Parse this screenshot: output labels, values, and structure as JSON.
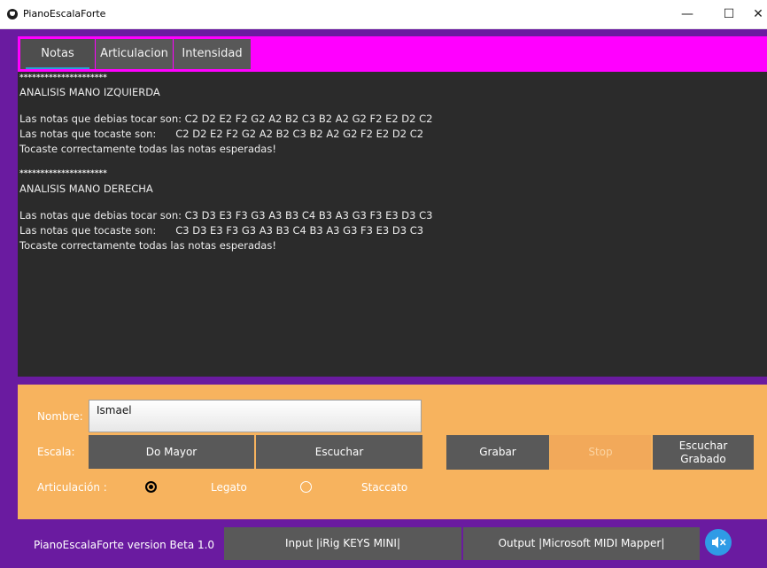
{
  "window": {
    "title": "PianoEscalaForte",
    "minimize": "—",
    "maximize": "☐",
    "close": "✕"
  },
  "tabs": [
    "Notas",
    "Articulacion",
    "Intensidad"
  ],
  "output": {
    "lines": [
      "*********************",
      "ANALISIS MANO IZQUIERDA",
      "",
      "Las notas que debias tocar son: C2 D2 E2 F2 G2 A2 B2 C3 B2 A2 G2 F2 E2 D2 C2",
      "Las notas que tocaste son:      C2 D2 E2 F2 G2 A2 B2 C3 B2 A2 G2 F2 E2 D2 C2",
      "Tocaste correctamente todas las notas esperadas!",
      "",
      "*********************",
      "ANALISIS MANO DERECHA",
      "",
      "Las notas que debias tocar son: C3 D3 E3 F3 G3 A3 B3 C4 B3 A3 G3 F3 E3 D3 C3",
      "Las notas que tocaste son:      C3 D3 E3 F3 G3 A3 B3 C4 B3 A3 G3 F3 E3 D3 C3",
      "Tocaste correctamente todas las notas esperadas!"
    ]
  },
  "form": {
    "nombre_label": "Nombre:",
    "nombre_value": "Ismael",
    "escala_label": "Escala:",
    "escala_value": "Do Mayor",
    "escuchar_label": "Escuchar",
    "grabar_label": "Grabar",
    "stop_label": "Stop",
    "escuchar_grabado_line1": "Escuchar",
    "escuchar_grabado_line2": "Grabado",
    "articulacion_label": "Articulación :",
    "legato_label": "Legato",
    "staccato_label": "Staccato",
    "articulacion_selected": "Legato"
  },
  "footer": {
    "version": "PianoEscalaForte version Beta 1.0",
    "input_device": "Input |iRig KEYS MINI|",
    "output_device": "Output |Microsoft MIDI Mapper|",
    "speaker_icon": "speaker-muted-icon"
  },
  "colors": {
    "frame": "#6a1ba0",
    "tabbar": "#ff00ff",
    "output_bg": "#2b2b2b",
    "form_bg": "#f7b35e",
    "button": "#595959",
    "stop_disabled": "#f2a95a",
    "speaker": "#2f9be6"
  }
}
